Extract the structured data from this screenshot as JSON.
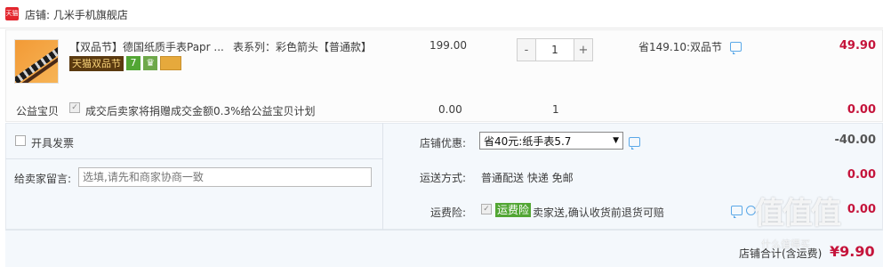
{
  "shop": {
    "badge": "天猫",
    "name_prefix": "店铺: ",
    "name": "几米手机旗舰店"
  },
  "item": {
    "title": "【双品节】德国纸质手表Papr ...",
    "sku": "表系列：彩色箭头【普通款】",
    "tags": [
      "天猫双品节",
      "7",
      "♛",
      ""
    ],
    "unit_price": "199.00",
    "quantity": "1",
    "minus_label": "-",
    "plus_label": "+",
    "discount_text": "省149.10:双品节",
    "subtotal": "49.90"
  },
  "charity": {
    "label": "公益宝贝",
    "check_mark": "✓",
    "text": "成交后卖家将捐赠成交金额0.3%给公益宝贝计划",
    "price": "0.00",
    "quantity": "1",
    "subtotal": "0.00"
  },
  "invoice": {
    "label": "开具发票"
  },
  "memo": {
    "label": "给卖家留言:",
    "placeholder": "选填,请先和商家协商一致"
  },
  "coupon": {
    "label": "店铺优惠:",
    "selected": "省40元:纸手表5.7",
    "arrow": "▼",
    "amount": "-40.00"
  },
  "shipping": {
    "label": "运送方式:",
    "value": "普通配送 快递 免邮",
    "amount": "0.00"
  },
  "insurance": {
    "label": "运费险:",
    "check_mark": "✓",
    "tag": "运费险",
    "text": "卖家送,确认收货前退货可赔",
    "amount": "0.00"
  },
  "footer": {
    "label": "店铺合计(含运费)",
    "total": "¥9.90"
  },
  "watermark": {
    "main": "值值值",
    "sub": "什么值得买"
  },
  "colors": {
    "price_red": "#c5143b",
    "tmall_red": "#e3262e",
    "chat_blue": "#5aa8e8",
    "green_tag": "#52a634"
  }
}
